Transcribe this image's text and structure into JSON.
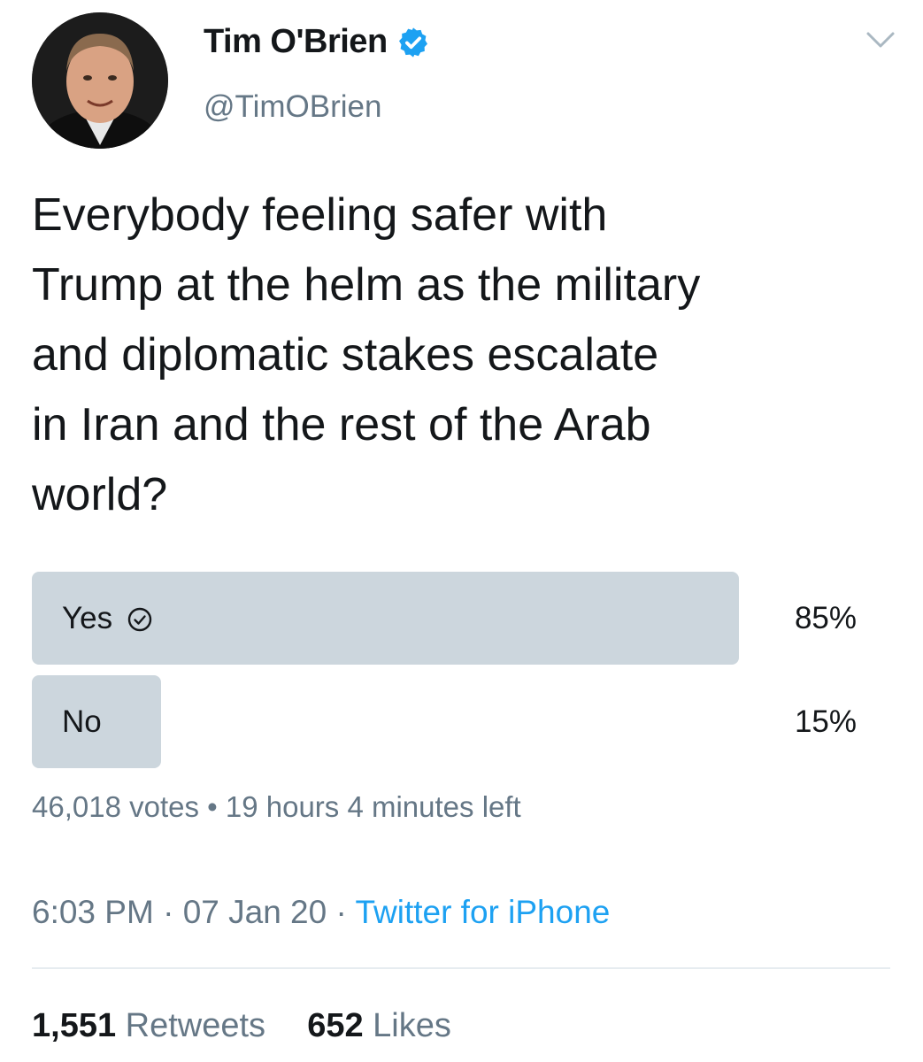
{
  "user": {
    "display_name": "Tim O'Brien",
    "handle": "@TimOBrien",
    "verified": true,
    "avatar_icon": "profile-photo",
    "verified_icon": "verified-badge-icon"
  },
  "tweet": {
    "text": "Everybody feeling safer with\nTrump at the helm as the military\nand diplomatic stakes escalate\nin Iran and the rest of the Arab\nworld?"
  },
  "poll": {
    "options": [
      {
        "label": "Yes",
        "percent_text": "85%",
        "share": 0.85,
        "voted": true
      },
      {
        "label": "No",
        "percent_text": "15%",
        "share": 0.15,
        "voted": false
      }
    ],
    "votes_text": "46,018 votes",
    "separator": " • ",
    "time_left_text": "19 hours 4 minutes left"
  },
  "meta": {
    "time": "6:03 PM",
    "date": "07 Jan 20",
    "dot": " · ",
    "source": "Twitter for iPhone"
  },
  "stats": {
    "retweets_count": "1,551",
    "retweets_label": "Retweets",
    "likes_count": "652",
    "likes_label": "Likes"
  },
  "colors": {
    "accent": "#1da1f2",
    "poll_fill": "#ccd6dd",
    "secondary_text": "#657786",
    "primary_text": "#14171a"
  }
}
